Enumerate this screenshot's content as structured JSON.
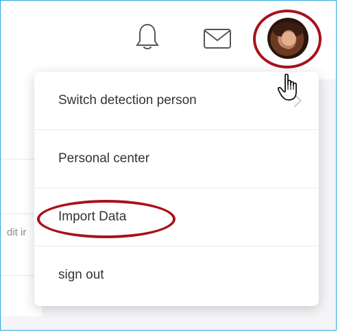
{
  "header": {
    "icons": [
      "bell-icon",
      "mail-icon"
    ],
    "avatar": "user-avatar"
  },
  "background": {
    "partial_text": "dit ir"
  },
  "menu": {
    "items": [
      {
        "label": "Switch detection person",
        "has_submenu": true
      },
      {
        "label": "Personal center",
        "has_submenu": false
      },
      {
        "label": "Import Data",
        "has_submenu": false
      },
      {
        "label": "sign out",
        "has_submenu": false
      }
    ]
  },
  "colors": {
    "highlight_ring": "#a7121a",
    "frame_border": "#29a8e0",
    "menu_text": "#333333"
  }
}
